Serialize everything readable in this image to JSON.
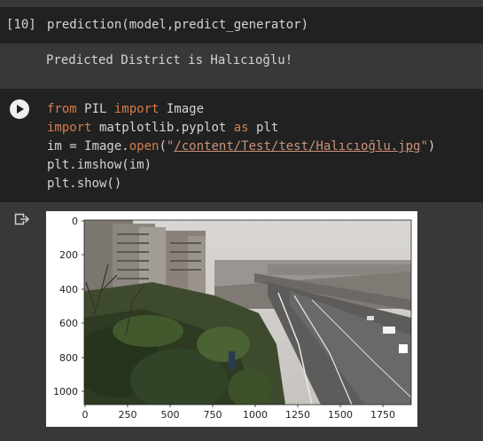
{
  "cell1": {
    "execution_count": "[10]",
    "code": "prediction(model,predict_generator)",
    "output": "Predicted District is Halıcıoğlu!"
  },
  "cell2": {
    "code_lines": [
      {
        "kw1": "from",
        "mid": " PIL ",
        "kw2": "import",
        "tail": " Image"
      },
      {
        "kw1": "import",
        "mid": " matplotlib.pyplot ",
        "kw2": "as",
        "tail": " plt"
      },
      {
        "pre": "im = Image.",
        "fn": "open",
        "paren": "(",
        "q1": "\"",
        "path": "/content/Test/test/Halıcıoğlu.jpg",
        "q2": "\"",
        "close": ")"
      },
      {
        "text": "plt.imshow(im)"
      },
      {
        "text": "plt.show()"
      }
    ]
  },
  "plot": {
    "y_ticks": [
      "0",
      "200",
      "400",
      "600",
      "800",
      "1000"
    ],
    "x_ticks": [
      "0",
      "250",
      "500",
      "750",
      "1000",
      "1250",
      "1500",
      "1750"
    ],
    "image_subject": "Halıcıoğlu road and hillside apartment view"
  },
  "icons": {
    "run": "play-circle-icon",
    "output": "output-arrow-icon"
  },
  "colors": {
    "keyword": "#d47d4b",
    "string": "#ce9178",
    "cell_bg": "#212121",
    "page_bg": "#383838",
    "text": "#d4d4d4"
  }
}
